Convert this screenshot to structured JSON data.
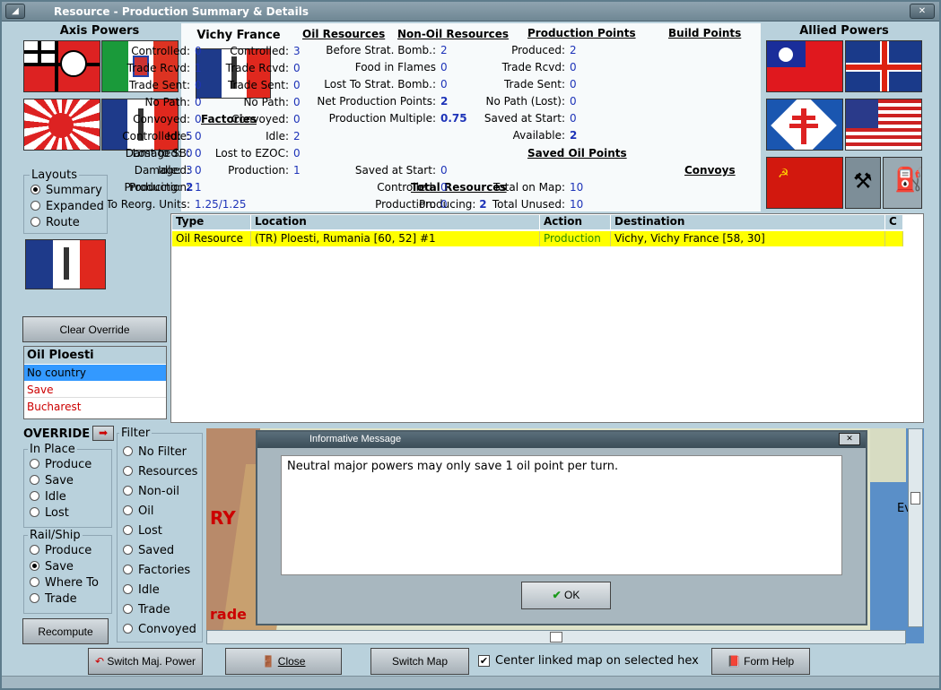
{
  "window": {
    "title": "Resource - Production Summary & Details"
  },
  "axis": {
    "title": "Axis Powers"
  },
  "allied": {
    "title": "Allied Powers"
  },
  "country": {
    "name": "Vichy France"
  },
  "factories": {
    "title": "Factories",
    "rows": [
      {
        "label": "Controlled:",
        "value": "5"
      },
      {
        "label": "Damaged:",
        "value": "0"
      },
      {
        "label": "Idle:",
        "value": "3"
      },
      {
        "label": "Producing:",
        "value": "2"
      }
    ]
  },
  "oil": {
    "title": "Oil Resources",
    "rows": [
      {
        "label": "Controlled:",
        "value": "0"
      },
      {
        "label": "Trade Rcvd:",
        "value": "1"
      },
      {
        "label": "Trade Sent:",
        "value": "0"
      },
      {
        "label": "No Path:",
        "value": "0"
      },
      {
        "label": "Convoyed:",
        "value": "0"
      },
      {
        "label": "Idle:",
        "value": "0"
      },
      {
        "label": "Lost to SB:",
        "value": "0"
      },
      {
        "label": "Damaged:",
        "value": "0"
      },
      {
        "label": "Production:",
        "value": "1"
      },
      {
        "label": "To Reorg. Units:",
        "value": "1.25/1.25"
      }
    ]
  },
  "nonoil": {
    "title": "Non-Oil Resources",
    "rows": [
      {
        "label": "Controlled:",
        "value": "3"
      },
      {
        "label": "Trade Rcvd:",
        "value": "0"
      },
      {
        "label": "Trade Sent:",
        "value": "0"
      },
      {
        "label": "No Path:",
        "value": "0"
      },
      {
        "label": "Convoyed:",
        "value": "0"
      },
      {
        "label": "Idle:",
        "value": "2"
      },
      {
        "label": "Lost to EZOC:",
        "value": "0"
      },
      {
        "label": "Production:",
        "value": "1"
      }
    ]
  },
  "total": {
    "title": "Total Resources",
    "label": "Producing:",
    "value": "2"
  },
  "prod": {
    "title": "Production Points",
    "rows": [
      {
        "label": "Before Strat. Bomb.:",
        "value": "2"
      },
      {
        "label": "Food in Flames",
        "value": "0"
      },
      {
        "label": "Lost To Strat. Bomb.:",
        "value": "0"
      },
      {
        "label": "Net Production Points:",
        "value": "2"
      },
      {
        "label": "Production Multiple:",
        "value": "0.75"
      }
    ]
  },
  "savedoil": {
    "title": "Saved Oil Points",
    "rows": [
      {
        "label": "Saved at Start:",
        "value": "0"
      },
      {
        "label": "Controlled:",
        "value": "0"
      },
      {
        "label": "Production:",
        "value": "0"
      }
    ]
  },
  "build": {
    "title": "Build Points",
    "rows": [
      {
        "label": "Produced:",
        "value": "2"
      },
      {
        "label": "Trade Rcvd:",
        "value": "0"
      },
      {
        "label": "Trade Sent:",
        "value": "0"
      },
      {
        "label": "No Path (Lost):",
        "value": "0"
      },
      {
        "label": "Saved at Start:",
        "value": "0"
      },
      {
        "label": "Available:",
        "value": "2"
      }
    ]
  },
  "convoys": {
    "title": "Convoys",
    "rows": [
      {
        "label": "Total on Map:",
        "value": "10"
      },
      {
        "label": "Total Unused:",
        "value": "10"
      }
    ]
  },
  "layouts": {
    "title": "Layouts",
    "options": [
      "Summary",
      "Expanded",
      "Route"
    ],
    "selected": 0
  },
  "override_btn": "Clear Override",
  "oillist": {
    "title": "Oil Ploesti",
    "items": [
      "No country",
      "Save",
      "Bucharest"
    ]
  },
  "table": {
    "headers": [
      "Type",
      "Location",
      "Action",
      "Destination",
      "C"
    ],
    "rows": [
      [
        "Oil Resource",
        "(TR) Ploesti, Rumania [60, 52] #1",
        "Production",
        "Vichy, Vichy France [58, 30]",
        ""
      ]
    ]
  },
  "override": {
    "title": "OVERRIDE",
    "inplace": {
      "title": "In Place",
      "options": [
        "Produce",
        "Save",
        "Idle",
        "Lost"
      ]
    },
    "railship": {
      "title": "Rail/Ship",
      "options": [
        "Produce",
        "Save",
        "Where To",
        "Trade"
      ],
      "selected": 1
    }
  },
  "filter": {
    "title": "Filter",
    "options": [
      "No Filter",
      "Resources",
      "Non-oil",
      "Oil",
      "Lost",
      "Saved",
      "Factories",
      "Idle",
      "Trade",
      "Convoyed"
    ]
  },
  "recompute": "Recompute",
  "msg": {
    "title": "Informative Message",
    "text": "Neutral major powers may only save 1 oil point per turn.",
    "ok": "OK"
  },
  "map": {
    "label1": "RY",
    "label2": "rade",
    "label3": "Ev"
  },
  "bottom": {
    "switch": "Switch Maj. Power",
    "close": "Close",
    "switchmap": "Switch Map",
    "center": "Center linked map on selected hex",
    "help": "Form Help"
  },
  "colors": {
    "highlight": "#ffff00",
    "value": "#1d33b8",
    "action": "#2a8a00",
    "selected": "#3399ff"
  }
}
